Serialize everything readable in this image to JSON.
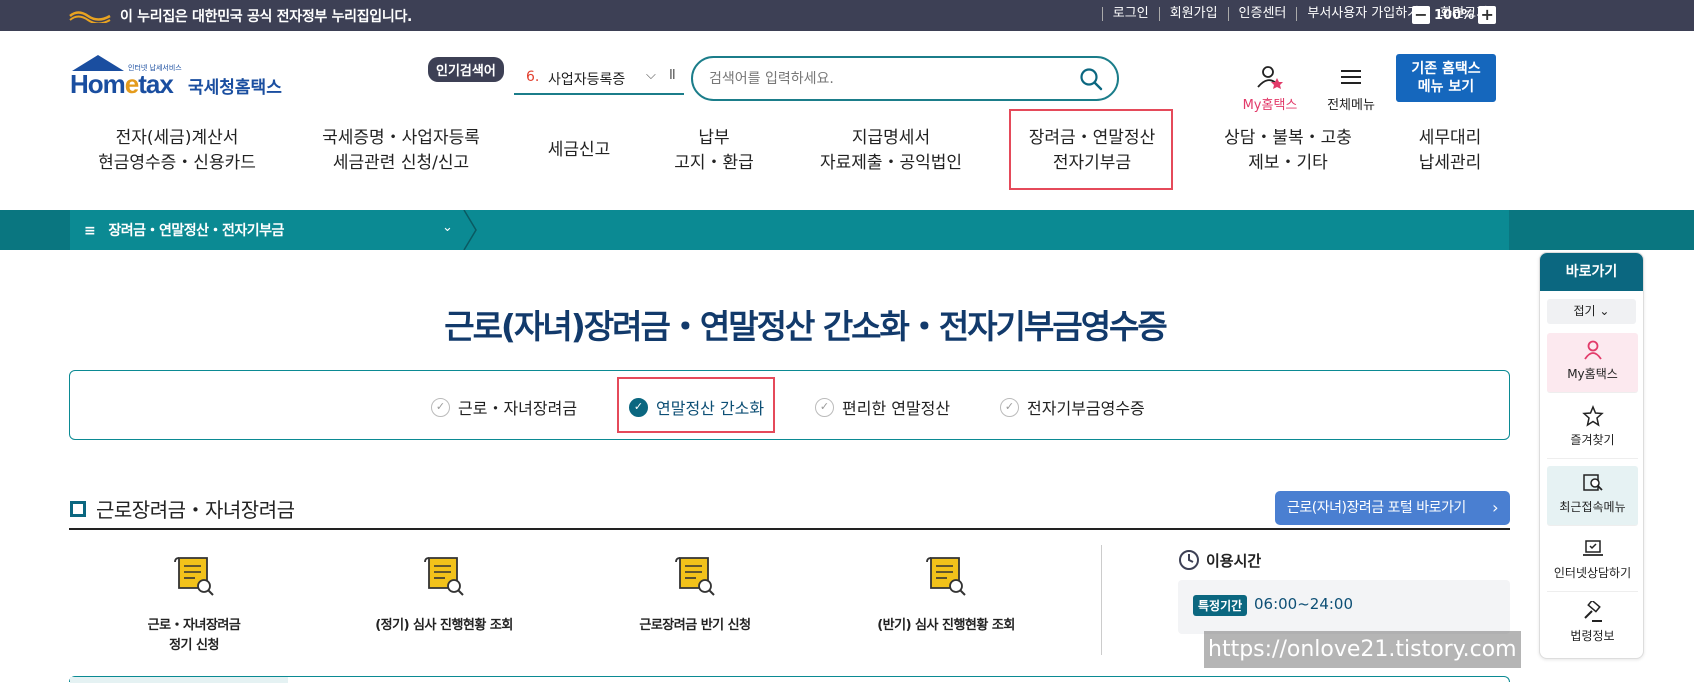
{
  "gov_banner": {
    "text": "이 누리집은 대한민국 공식 전자정부 누리집입니다.",
    "links": [
      "로그인",
      "회원가입",
      "인증센터",
      "부서사용자 가입하기",
      "화면크기"
    ],
    "zoom": "100%",
    "zoom_out": "−",
    "zoom_in": "+"
  },
  "brand": {
    "name_en_1": "Hom",
    "name_en_2": "e",
    "name_en_3": "tax",
    "name_kr": "국세청홈택스",
    "tagline": "인터넷 납세서비스"
  },
  "popular": {
    "label": "인기검색어",
    "rank": "6.",
    "keyword": "사업자등록증",
    "chevron": "⌵",
    "pause": "II"
  },
  "search": {
    "placeholder": "검색어를 입력하세요."
  },
  "header_menu": {
    "my_label": "My홈택스",
    "all_label": "전체메뉴",
    "classic_line1": "기존 홈택스",
    "classic_line2": "메뉴 보기"
  },
  "nav": [
    "전자(세금)계산서\n현금영수증・신용카드",
    "국세증명・사업자등록\n세금관련 신청/신고",
    "세금신고",
    "납부\n고지・환급",
    "지급명세서\n자료제출・공익법인",
    "장려금・연말정산\n전자기부금",
    "상담・불복・고충\n제보・기타",
    "세무대리\n납세관리"
  ],
  "breadcrumb": {
    "icon": "≡",
    "label": "장려금・연말정산・전자기부금",
    "chevron": "⌄"
  },
  "page_title": "근로(자녀)장려금・연말정산 간소화・전자기부금영수증",
  "tabs": [
    {
      "label": "근로・자녀장려금",
      "active": false
    },
    {
      "label": "연말정산 간소화",
      "active": true
    },
    {
      "label": "편리한 연말정산",
      "active": false
    },
    {
      "label": "전자기부금영수증",
      "active": false
    }
  ],
  "check_glyph": "✓",
  "section": {
    "title": "근로장려금・자녀장려금",
    "portal_button": "근로(자녀)장려금 포털 바로가기",
    "arrow": "›"
  },
  "services": [
    {
      "line1": "근로・자녀장려금",
      "line2": "정기 신청"
    },
    {
      "line1": "(정기) 심사 진행현황 조회",
      "line2": ""
    },
    {
      "line1": "근로장려금 반기 신청",
      "line2": ""
    },
    {
      "line1": "(반기) 심사 진행현황 조회",
      "line2": ""
    }
  ],
  "usage": {
    "title": "이용시간",
    "badge": "특정기간",
    "hours": "06:00~24:00"
  },
  "quick": {
    "title": "바로가기",
    "fold": "접기 ⌄",
    "items": [
      "My홈택스",
      "즐겨찾기",
      "최근접속메뉴",
      "인터넷상담하기",
      "법령정보"
    ]
  },
  "watermark": "https://onlove21.tistory.com",
  "colors": {
    "teal": "#0b8a93",
    "navy": "#3d4055",
    "highlight": "#e54a5a",
    "blue_btn": "#1567bd",
    "title": "#123a6b"
  }
}
